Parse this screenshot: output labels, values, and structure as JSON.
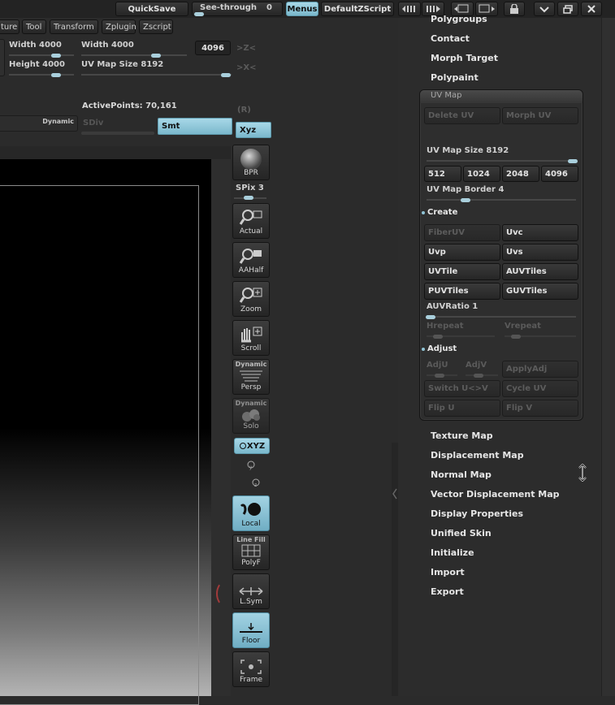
{
  "topbar": {
    "quicksave": "QuickSave",
    "see_through_label": "See-through",
    "see_through_value": "0",
    "menus": "Menus",
    "default_zscript": "DefaultZScript"
  },
  "menubar": {
    "items": [
      "ture",
      "Tool",
      "Transform",
      "Zplugin",
      "Zscript"
    ]
  },
  "texture_panel": {
    "width_a": "Width 4000",
    "width_b": "Width 4000",
    "height_a": "Height 4000",
    "uv_map_size": "UV Map Size 8192",
    "size_box": "4096",
    "zlt_label": ">Z<",
    "xlt_label": ">X<"
  },
  "status": {
    "active_points": "ActivePoints: 70,161",
    "r_label": "(R)",
    "dynamic": "Dynamic",
    "sdiv": "SDiv",
    "smt": "Smt",
    "xyz": "Xyz"
  },
  "right_shelf": {
    "bpr": "BPR",
    "spix": "SPix 3",
    "actual": "Actual",
    "aahalf": "AAHalf",
    "zoom": "Zoom",
    "scroll": "Scroll",
    "persp_top": "Dynamic",
    "persp": "Persp",
    "solo_top": "Dynamic",
    "solo": "Solo",
    "xyz": "XYZ",
    "local": "Local",
    "polyf_top": "Line Fill",
    "polyf": "PolyF",
    "lsym": "L.Sym",
    "floor": "Floor",
    "frame": "Frame"
  },
  "tool_menu": {
    "items_top": [
      "Polygroups",
      "Contact",
      "Morph Target",
      "Polypaint"
    ],
    "uv_map": {
      "title": "UV Map",
      "delete_uv": "Delete UV",
      "morph_uv": "Morph UV",
      "uv_map_size": "UV Map Size 8192",
      "uv_map_size_fraction": 1.0,
      "sizes": [
        "512",
        "1024",
        "2048",
        "4096"
      ],
      "uv_map_border": "UV Map Border 4",
      "uv_map_border_fraction": 0.25,
      "create_label": "Create",
      "create_buttons": [
        "FiberUV",
        "Uvc",
        "Uvp",
        "Uvs",
        "UVTile",
        "AUVTiles",
        "PUVTiles",
        "GUVTiles"
      ],
      "auvratio": "AUVRatio 1",
      "auvratio_fraction": 0.0,
      "hrepeat": "Hrepeat",
      "vrepeat": "Vrepeat",
      "adjust_label": "Adjust",
      "adju": "AdjU",
      "adjv": "AdjV",
      "applyadj": "ApplyAdj",
      "switch_uv": "Switch U<>V",
      "cycle_uv": "Cycle UV",
      "flip_u": "Flip U",
      "flip_v": "Flip V"
    },
    "items_bottom": [
      "Texture Map",
      "Displacement Map",
      "Normal Map",
      "Vector Displacement Map",
      "Display Properties",
      "Unified Skin",
      "Initialize",
      "Import",
      "Export"
    ]
  }
}
